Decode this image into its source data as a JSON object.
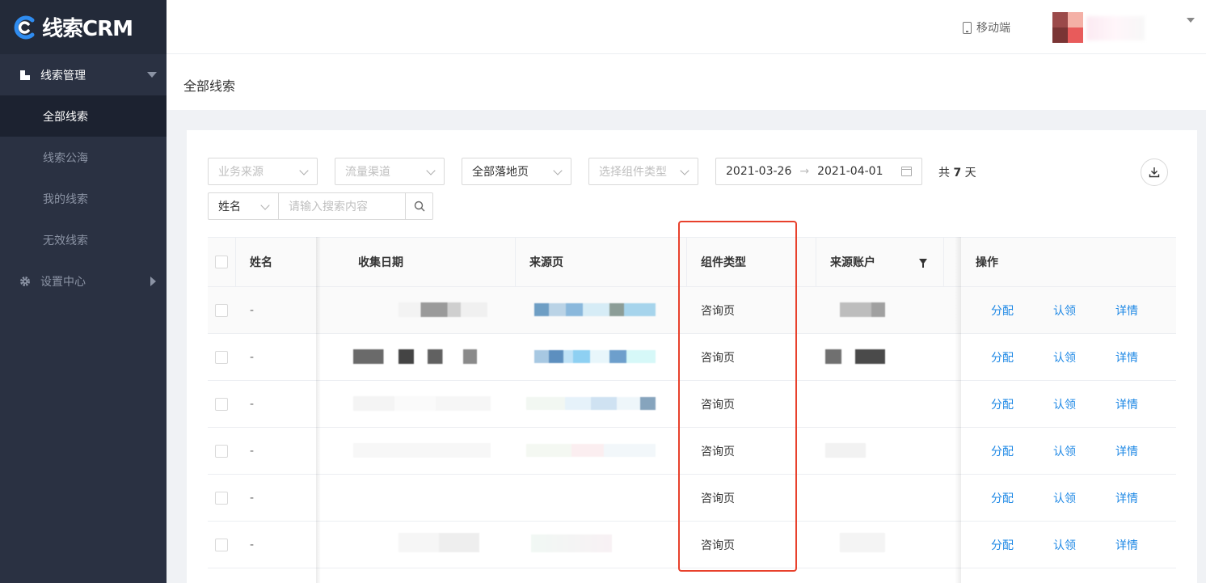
{
  "app": {
    "title": "线索CRM"
  },
  "sidebar": {
    "groups": [
      {
        "label": "线索管理",
        "items": [
          {
            "label": "全部线索",
            "active": true
          },
          {
            "label": "线索公海",
            "active": false
          },
          {
            "label": "我的线索",
            "active": false
          },
          {
            "label": "无效线索",
            "active": false
          }
        ]
      },
      {
        "label": "设置中心"
      }
    ]
  },
  "header": {
    "mobile_label": "移动端"
  },
  "page": {
    "title": "全部线索"
  },
  "filters": {
    "business_source": {
      "placeholder": "业务来源"
    },
    "traffic_channel": {
      "placeholder": "流量渠道"
    },
    "landing_page": {
      "value": "全部落地页"
    },
    "component_type": {
      "placeholder": "选择组件类型"
    },
    "date_start": "2021-03-26",
    "date_end": "2021-04-01",
    "days_prefix": "共",
    "days_count": "7",
    "days_suffix": "天",
    "search_field": "姓名",
    "search_placeholder": "请输入搜索内容"
  },
  "table": {
    "columns": [
      "姓名",
      "收集日期",
      "来源页",
      "组件类型",
      "来源账户",
      "操作"
    ],
    "rows": [
      {
        "name": "-",
        "component_type": "咨询页"
      },
      {
        "name": "-",
        "component_type": "咨询页"
      },
      {
        "name": "-",
        "component_type": "咨询页"
      },
      {
        "name": "-",
        "component_type": "咨询页"
      },
      {
        "name": "-",
        "component_type": "咨询页"
      },
      {
        "name": "-",
        "component_type": "咨询页"
      }
    ],
    "actions": {
      "assign": "分配",
      "claim": "认领",
      "detail": "详情"
    }
  },
  "colors": {
    "accent": "#1e88e5",
    "sidebar_bg": "#2a3142",
    "highlight": "#e8412c"
  }
}
